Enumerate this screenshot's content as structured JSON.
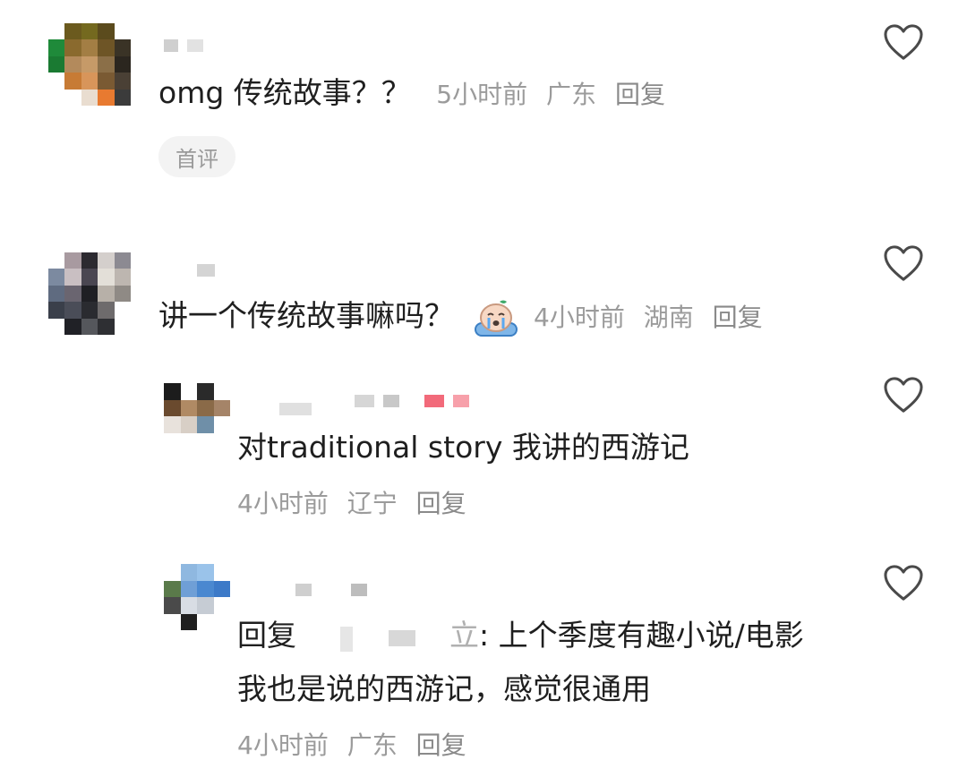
{
  "comments": [
    {
      "text": "omg 传统故事？？",
      "time": "5小时前",
      "location": "广东",
      "reply_label": "回复",
      "badge": "首评",
      "avatar_colors": [
        "#ffffff",
        "#6b5a1e",
        "#74691f",
        "#5b4b1d",
        "#ffffff",
        "#1f8a3a",
        "#8a6a2e",
        "#a37e44",
        "#6e5526",
        "#3a3326",
        "#1a7a32",
        "#b38a5c",
        "#c69a68",
        "#8b6f48",
        "#2b261f",
        "#ffffff",
        "#c77b35",
        "#d8955a",
        "#7a5a33",
        "#4a4035",
        "#ffffff",
        "#ffffff",
        "#e9ddd0",
        "#e87a30",
        "#3b3b3b"
      ]
    },
    {
      "text": "讲一个传统故事嘛吗？",
      "time": "4小时前",
      "location": "湖南",
      "reply_label": "回复",
      "avatar_colors": [
        "#ffffff",
        "#a89aa0",
        "#2c2a30",
        "#d4cfcc",
        "#8c8a92",
        "#7c8aa0",
        "#c9bfc2",
        "#4a4651",
        "#e3dfd8",
        "#bdb6b0",
        "#5f6b80",
        "#6a6570",
        "#1f1f24",
        "#b7b0a8",
        "#8f8a85",
        "#3a3f4a",
        "#4a4d58",
        "#2a2b30",
        "#6e6b6c",
        "#ffffff",
        "#ffffff",
        "#202126",
        "#55575c",
        "#2e2f33",
        "#ffffff"
      ]
    }
  ],
  "replies": [
    {
      "text": "对traditional story 我讲的西游记",
      "time": "4小时前",
      "location": "辽宁",
      "reply_label": "回复",
      "avatar_colors": [
        "#1c1c1c",
        "#ffffff",
        "#2a2a2a",
        "#ffffff",
        "#6a4a2e",
        "#b08a64",
        "#8a6a48",
        "#a58468",
        "#e8e2dc",
        "#d8cfc6",
        "#6f8fa8",
        "#ffffff",
        "#ffffff",
        "#ffffff",
        "#ffffff",
        "#ffffff"
      ]
    },
    {
      "prefix": "回复",
      "name_tail": "立",
      "text": "上个季度有趣小说/电影我也是说的西游记，感觉很通用",
      "time": "4小时前",
      "location": "广东",
      "reply_label": "回复",
      "avatar_colors": [
        "#ffffff",
        "#8fb8e0",
        "#9ac3ea",
        "#ffffff",
        "#5a7a4a",
        "#6f9fd6",
        "#4a88d0",
        "#3d7ac8",
        "#4a4a4a",
        "#d8dde4",
        "#c6ccd4",
        "#ffffff",
        "#ffffff",
        "#1f1f1f",
        "#ffffff",
        "#ffffff"
      ]
    }
  ],
  "icons": {
    "like": "heart-outline-icon",
    "emoji": "crying-emoji-icon"
  },
  "colors": {
    "text": "#1f1f1f",
    "meta": "#9b9b9b",
    "heart": "#4a4a4a",
    "badge_bg": "#f3f3f3"
  }
}
